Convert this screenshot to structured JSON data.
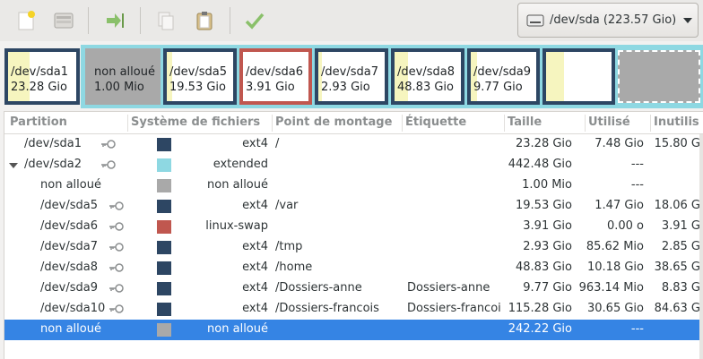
{
  "toolbar": {
    "buttons": [
      {
        "name": "new-partition-icon"
      },
      {
        "name": "delete-partition-icon"
      },
      {
        "name": "resize-move-icon"
      },
      {
        "name": "copy-icon"
      },
      {
        "name": "paste-icon"
      },
      {
        "name": "apply-icon"
      }
    ],
    "device": "/dev/sda (223.57 Gio)"
  },
  "map": {
    "segments": [
      {
        "name": "/dev/sda1",
        "size": "23.28 Gio",
        "border": "#2d4663",
        "used_fraction": 0.32
      },
      {
        "name": "non alloué",
        "size": "1.00 Mio",
        "border": "#a9a9a9",
        "used_fraction": 0
      },
      {
        "name": "/dev/sda5",
        "size": "19.53 Gio",
        "border": "#2d4663",
        "used_fraction": 0.08
      },
      {
        "name": "/dev/sda6",
        "size": "3.91 Gio",
        "border": "#c0574f",
        "used_fraction": 0
      },
      {
        "name": "/dev/sda7",
        "size": "2.93 Gio",
        "border": "#2d4663",
        "used_fraction": 0.05
      },
      {
        "name": "/dev/sda8",
        "size": "48.83 Gio",
        "border": "#2d4663",
        "used_fraction": 0.2
      },
      {
        "name": "/dev/sda9",
        "size": "9.77 Gio",
        "border": "#2d4663",
        "used_fraction": 0.1
      },
      {
        "name": "",
        "size": "",
        "border": "#2d4663",
        "used_fraction": 0.27
      },
      {
        "name": "",
        "size": "",
        "border": "#a9a9a9",
        "used_fraction": 0
      }
    ]
  },
  "list": {
    "headers": [
      "Partition",
      "Système de fichiers",
      "Point de montage",
      "Étiquette",
      "Taille",
      "Utilisé",
      "Inutilis"
    ],
    "rows": [
      {
        "partition": "/dev/sda1",
        "key": true,
        "color": "#2d4663",
        "fs": "ext4",
        "mount": "/",
        "label": "",
        "size": "23.28 Gio",
        "used": "7.48 Gio",
        "unused": "15.80 G",
        "indent": 0
      },
      {
        "partition": "/dev/sda2",
        "key": true,
        "color": "#8ed8e2",
        "fs": "extended",
        "mount": "",
        "label": "",
        "size": "442.48 Gio",
        "used": "---",
        "unused": "",
        "indent": 0,
        "expander": true
      },
      {
        "partition": "non alloué",
        "key": false,
        "color": "#a9a9a9",
        "fs": "non alloué",
        "mount": "",
        "label": "",
        "size": "1.00 Mio",
        "used": "---",
        "unused": "",
        "indent": 1
      },
      {
        "partition": "/dev/sda5",
        "key": true,
        "color": "#2d4663",
        "fs": "ext4",
        "mount": "/var",
        "label": "",
        "size": "19.53 Gio",
        "used": "1.47 Gio",
        "unused": "18.06 G",
        "indent": 1
      },
      {
        "partition": "/dev/sda6",
        "key": true,
        "color": "#c0574f",
        "fs": "linux-swap",
        "mount": "",
        "label": "",
        "size": "3.91 Gio",
        "used": "0.00 o",
        "unused": "3.91 G",
        "indent": 1
      },
      {
        "partition": "/dev/sda7",
        "key": true,
        "color": "#2d4663",
        "fs": "ext4",
        "mount": "/tmp",
        "label": "",
        "size": "2.93 Gio",
        "used": "85.62 Mio",
        "unused": "2.85 G",
        "indent": 1
      },
      {
        "partition": "/dev/sda8",
        "key": true,
        "color": "#2d4663",
        "fs": "ext4",
        "mount": "/home",
        "label": "",
        "size": "48.83 Gio",
        "used": "10.18 Gio",
        "unused": "38.65 G",
        "indent": 1
      },
      {
        "partition": "/dev/sda9",
        "key": true,
        "color": "#2d4663",
        "fs": "ext4",
        "mount": "/Dossiers-anne",
        "label": "Dossiers-anne",
        "size": "9.77 Gio",
        "used": "963.14 Mio",
        "unused": "8.83 G",
        "indent": 1
      },
      {
        "partition": "/dev/sda10",
        "key": true,
        "color": "#2d4663",
        "fs": "ext4",
        "mount": "/Dossiers-francois",
        "label": "Dossiers-francoi",
        "size": "115.28 Gio",
        "used": "30.65 Gio",
        "unused": "84.63 G",
        "indent": 1
      },
      {
        "partition": "non alloué",
        "key": false,
        "color": "#a9a9a9",
        "fs": "non alloué",
        "mount": "",
        "label": "",
        "size": "242.22 Gio",
        "used": "---",
        "unused": "",
        "indent": 1,
        "selected": true
      }
    ]
  }
}
